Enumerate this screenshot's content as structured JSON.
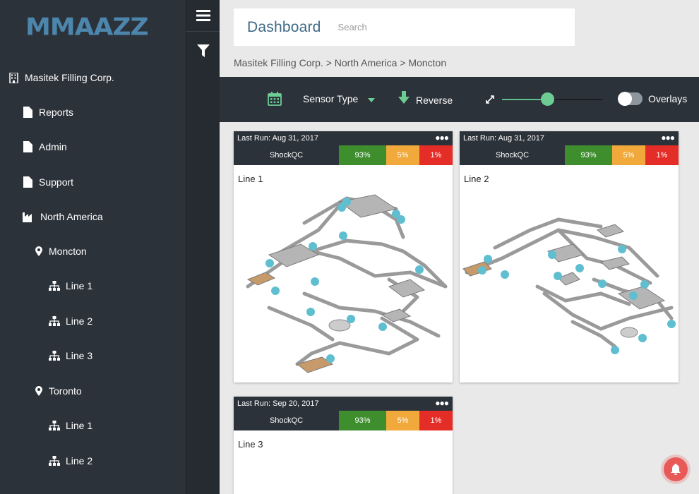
{
  "brand": {
    "logo": "MMAAZZ",
    "logo_color": "#4c86ad"
  },
  "sidebar": {
    "items": [
      {
        "label": "Masitek Filling Corp.",
        "icon": "building-icon"
      },
      {
        "label": "Reports",
        "icon": "document-icon"
      },
      {
        "label": "Admin",
        "icon": "document-icon"
      },
      {
        "label": "Support",
        "icon": "document-icon"
      },
      {
        "label": "North America",
        "icon": "factory-icon"
      },
      {
        "label": "Moncton",
        "icon": "map-pin-icon"
      },
      {
        "label": "Line 1",
        "icon": "hierarchy-icon"
      },
      {
        "label": "Line 2",
        "icon": "hierarchy-icon"
      },
      {
        "label": "Line 3",
        "icon": "hierarchy-icon"
      },
      {
        "label": "Toronto",
        "icon": "map-pin-icon"
      },
      {
        "label": "Line 1",
        "icon": "hierarchy-icon"
      },
      {
        "label": "Line 2",
        "icon": "hierarchy-icon"
      }
    ]
  },
  "rail": {
    "menu_icon": "hamburger-icon",
    "filter_icon": "filter-icon"
  },
  "header": {
    "title": "Dashboard",
    "search_placeholder": "Search"
  },
  "breadcrumb": "Masitek Filling Corp. > North America > Moncton",
  "toolbar": {
    "calendar_icon": "calendar-icon",
    "sensor_type": "Sensor Type",
    "reverse": "Reverse",
    "expand_icon": "expand-icon",
    "zoom_level": 0.45,
    "overlays": "Overlays",
    "overlays_on": false
  },
  "cards": [
    {
      "last_run": "Last Run: Aug 31, 2017",
      "metric": "ShockQC",
      "green": "93%",
      "orange": "5%",
      "red": "1%",
      "line": "Line 1"
    },
    {
      "last_run": "Last Run: Aug 31, 2017",
      "metric": "ShockQC",
      "green": "93%",
      "orange": "5%",
      "red": "1%",
      "line": "Line 2"
    },
    {
      "last_run": "Last Run: Sep 20, 2017",
      "metric": "ShockQC",
      "green": "93%",
      "orange": "5%",
      "red": "1%",
      "line": "Line 3"
    }
  ],
  "colors": {
    "sidebar": "#2c323a",
    "accent": "#6dcc94",
    "good": "#3e8e2e",
    "warn": "#f0a93a",
    "bad": "#e52d27",
    "sensor": "#5fbfd0"
  }
}
